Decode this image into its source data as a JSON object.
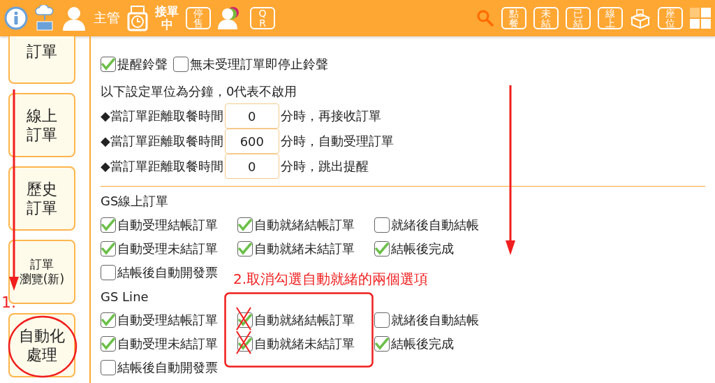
{
  "toolbar": {
    "user_label": "主管",
    "status_lines": [
      "接單",
      "中"
    ],
    "left_tiles": [
      "停售",
      "QR"
    ],
    "right_tiles": [
      "點餐",
      "未結",
      "已結",
      "線上"
    ],
    "seat_tile": "座位"
  },
  "sidebar": {
    "items": [
      {
        "lines": [
          "訂單"
        ]
      },
      {
        "lines": [
          "線上",
          "訂單"
        ]
      },
      {
        "lines": [
          "歷史",
          "訂單"
        ]
      },
      {
        "lines": [
          "訂單",
          "瀏覽(新)"
        ]
      },
      {
        "lines": [
          "自動化",
          "處理"
        ]
      }
    ]
  },
  "alerts": [
    {
      "label": "提醒鈴聲",
      "checked": true
    },
    {
      "label": "無未受理訂單即停止鈴聲",
      "checked": false
    }
  ],
  "timer_note": "以下設定單位為分鐘，0代表不啟用",
  "timers": [
    {
      "prefix": "◆當訂單距離取餐時間",
      "value": "0",
      "suffix": "分時，再接收訂單"
    },
    {
      "prefix": "◆當訂單距離取餐時間",
      "value": "600",
      "suffix": "分時，自動受理訂單"
    },
    {
      "prefix": "◆當訂單距離取餐時間",
      "value": "0",
      "suffix": "分時，跳出提醒"
    }
  ],
  "groups": [
    {
      "title": "GS線上訂單",
      "options": [
        {
          "label": "自動受理結帳訂單",
          "checked": true,
          "crossed_out": false
        },
        {
          "label": "自動就緒結帳訂單",
          "checked": true,
          "crossed_out": false
        },
        {
          "label": "就緒後自動結帳",
          "checked": false,
          "crossed_out": false
        },
        {
          "label": "自動受理未結訂單",
          "checked": true,
          "crossed_out": false
        },
        {
          "label": "自動就緒未結訂單",
          "checked": true,
          "crossed_out": false
        },
        {
          "label": "結帳後完成",
          "checked": true,
          "crossed_out": false
        },
        {
          "label": "結帳後自動開發票",
          "checked": false,
          "crossed_out": false
        }
      ]
    },
    {
      "title": "GS Line",
      "options": [
        {
          "label": "自動受理結帳訂單",
          "checked": true,
          "crossed_out": false
        },
        {
          "label": "自動就緒結帳訂單",
          "checked": true,
          "crossed_out": true
        },
        {
          "label": "就緒後自動結帳",
          "checked": false,
          "crossed_out": false
        },
        {
          "label": "自動受理未結訂單",
          "checked": true,
          "crossed_out": false
        },
        {
          "label": "自動就緒未結訂單",
          "checked": true,
          "crossed_out": true
        },
        {
          "label": "結帳後完成",
          "checked": true,
          "crossed_out": false
        },
        {
          "label": "結帳後自動開發票",
          "checked": false,
          "crossed_out": false
        }
      ]
    }
  ],
  "annotations": {
    "step1": "1.",
    "step2": "2.取消勾選自動就緒的兩個選項"
  }
}
